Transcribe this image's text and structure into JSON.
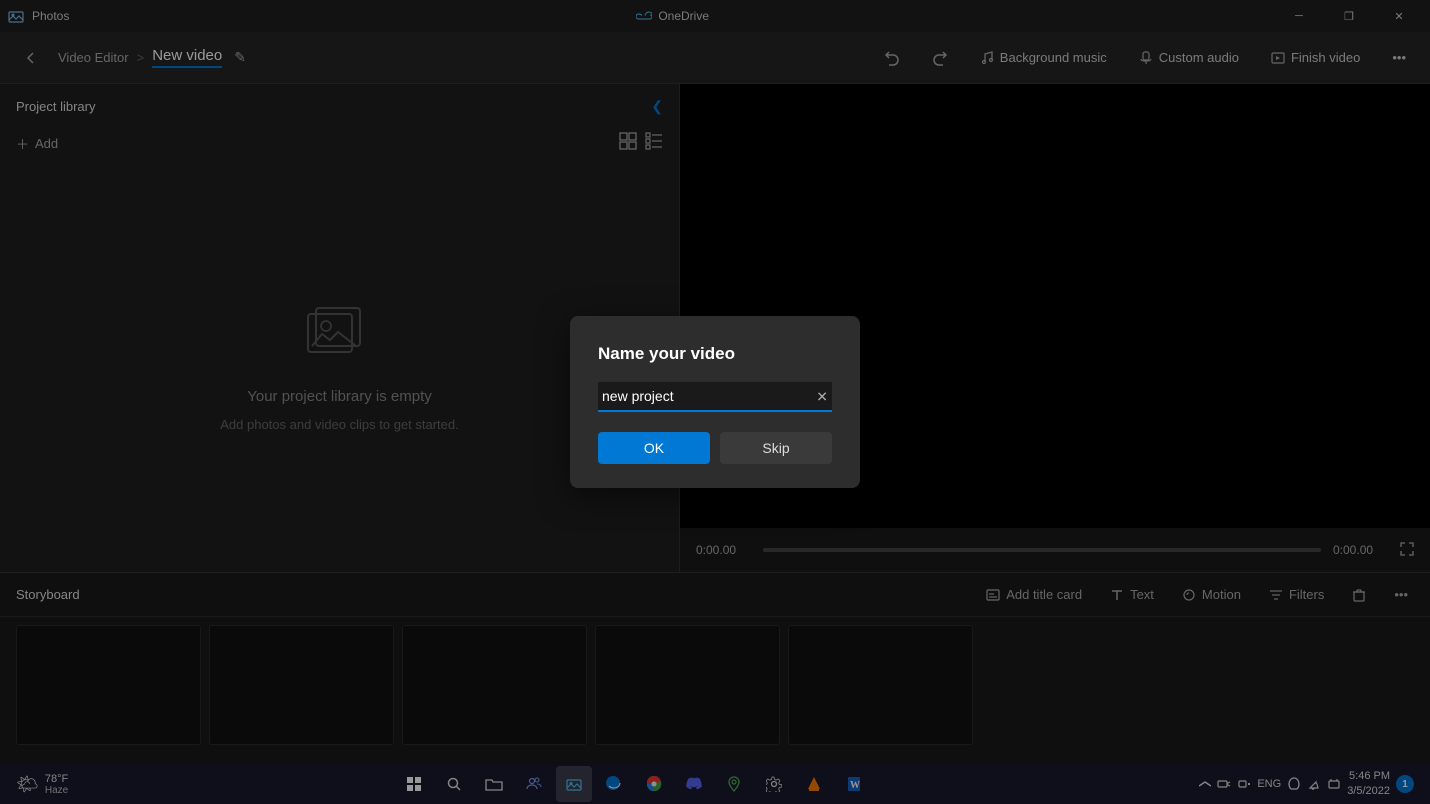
{
  "titlebar": {
    "app_name": "Photos",
    "onedrive_label": "OneDrive",
    "minimize_label": "─",
    "restore_label": "❐",
    "close_label": "✕"
  },
  "toolbar": {
    "breadcrumb_parent": "Video Editor",
    "breadcrumb_sep": ">",
    "title": "New video",
    "edit_icon": "✎",
    "undo_icon": "↩",
    "redo_icon": "↪",
    "bg_music_label": "Background music",
    "custom_audio_label": "Custom audio",
    "finish_video_label": "Finish video",
    "more_icon": "•••"
  },
  "project_library": {
    "title": "Project library",
    "add_label": "Add",
    "collapse_icon": "❮",
    "empty_title": "Your project library is empty",
    "empty_subtitle": "Add photos and video clips to get started."
  },
  "video_preview": {
    "time_start": "0:00.00",
    "time_end": "0:00.00"
  },
  "storyboard": {
    "title": "Storyboard",
    "add_title_card_label": "Add title card",
    "text_label": "Text",
    "motion_label": "Motion",
    "filters_label": "Filters",
    "delete_icon": "🗑",
    "more_icon": "•••"
  },
  "dialog": {
    "title": "Name your video",
    "input_value": "new project",
    "ok_label": "OK",
    "skip_label": "Skip",
    "clear_icon": "✕"
  },
  "taskbar": {
    "weather_temp": "78°F",
    "weather_condition": "Haze",
    "weather_emoji": "🌤",
    "time": "5:46 PM",
    "date": "3/5/2022",
    "language": "ENG",
    "notification_count": "1"
  }
}
